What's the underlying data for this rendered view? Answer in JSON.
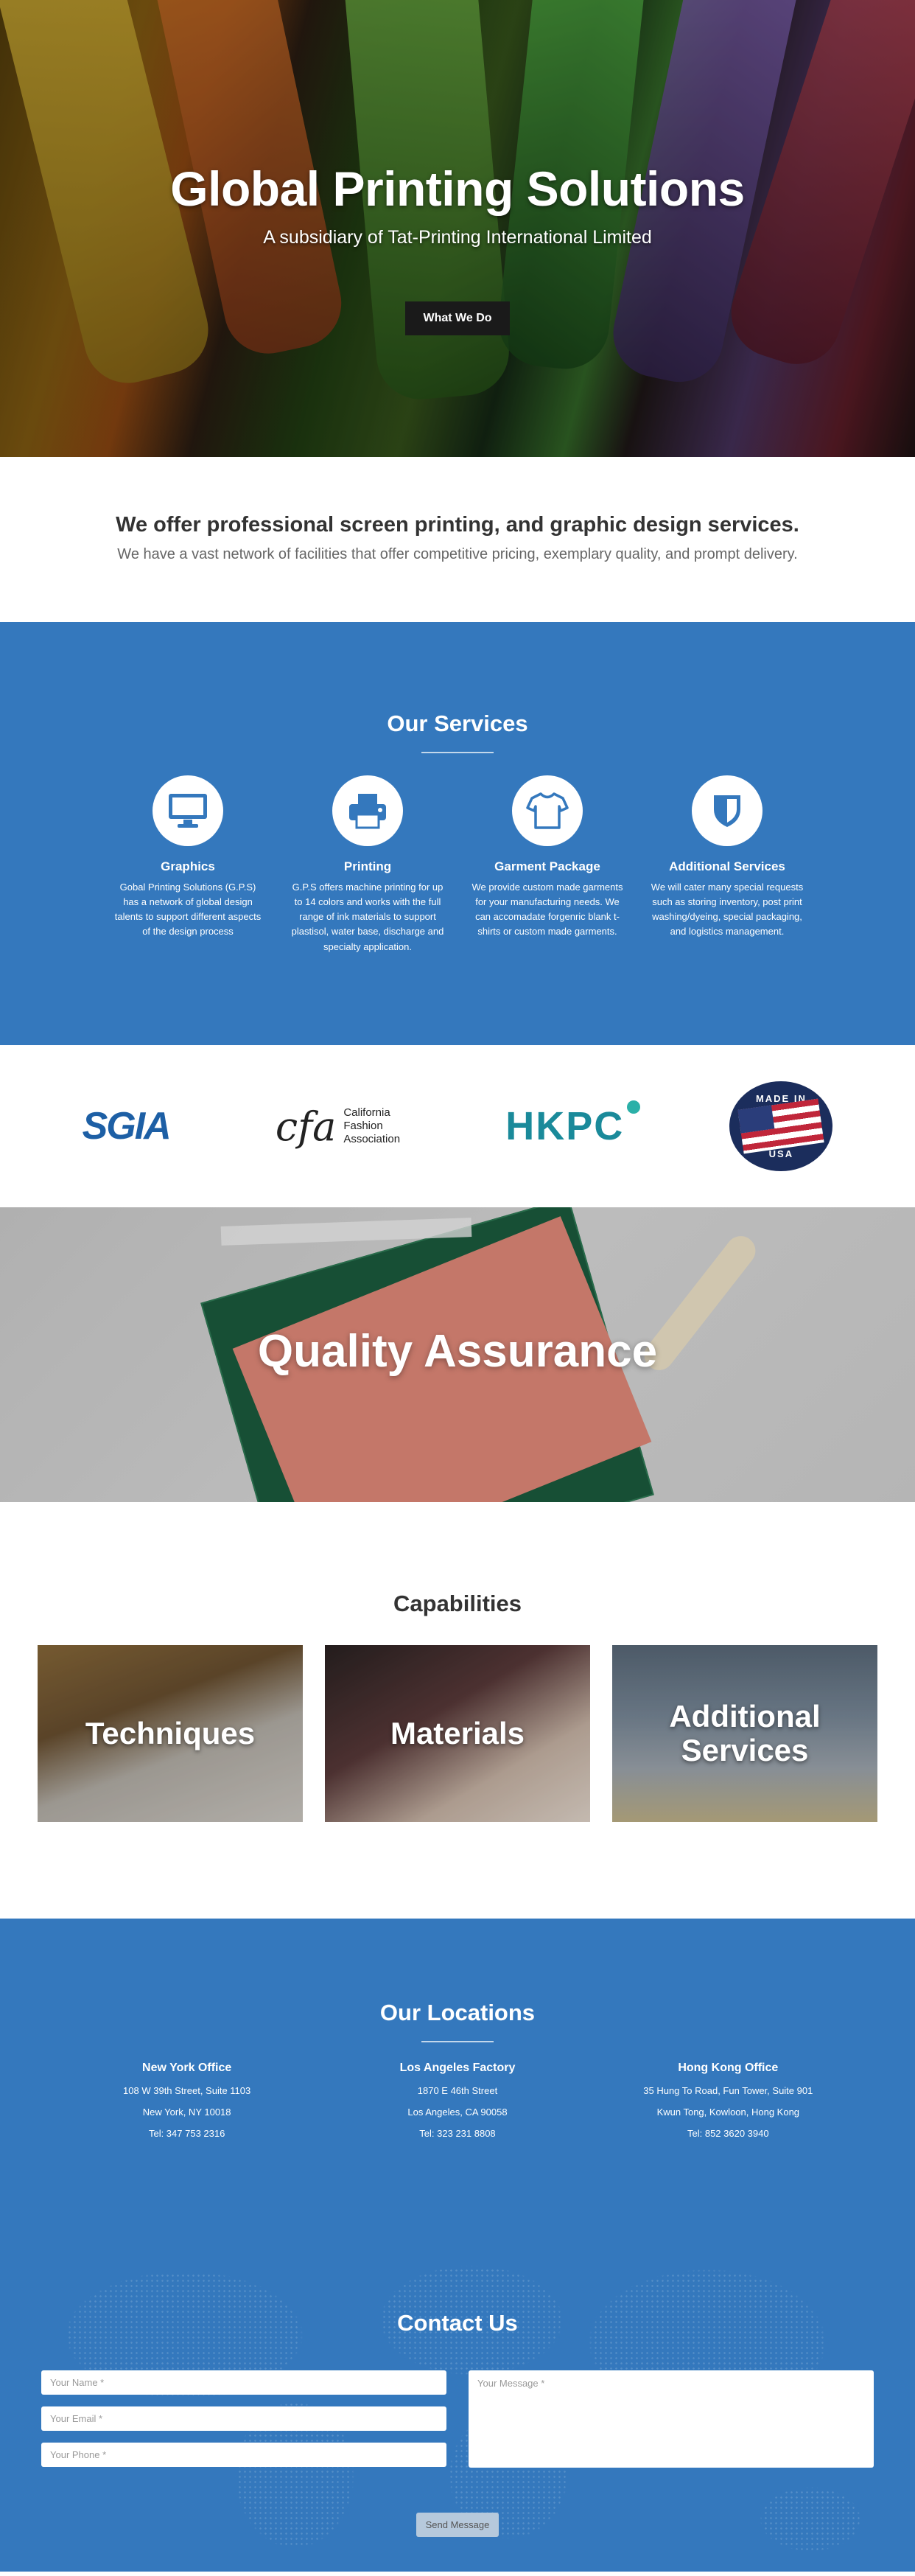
{
  "hero": {
    "title": "Global Printing Solutions",
    "subtitle": "A subsidiary of Tat-Printing International Limited",
    "button_label": "What We Do"
  },
  "intro": {
    "heading": "We offer professional screen printing, and graphic design services.",
    "subheading": "We have a vast network of facilities that offer competitive pricing, exemplary quality, and prompt delivery."
  },
  "services": {
    "title": "Our Services",
    "accent_color": "#3478bd",
    "items": [
      {
        "icon": "monitor-icon",
        "name": "Graphics",
        "description": "Gobal Printing Solutions (G.P.S) has a network of global design talents to support different aspects of the design process"
      },
      {
        "icon": "printer-icon",
        "name": "Printing",
        "description": "G.P.S offers machine printing for up to 14 colors and works with the full range of ink materials to support plastisol, water base, discharge and specialty application."
      },
      {
        "icon": "tshirt-icon",
        "name": "Garment Package",
        "description": "We provide custom made garments for your manufacturing needs. We can accomadate forgenric blank t-shirts or custom made garments."
      },
      {
        "icon": "shield-icon",
        "name": "Additional Services",
        "description": "We will cater many special requests such as storing inventory, post print washing/dyeing, special packaging, and logistics management."
      }
    ]
  },
  "partners": {
    "sgia": "SGIA",
    "cfa_mark": "cfa",
    "cfa_lines": [
      "California",
      "Fashion",
      "Association"
    ],
    "hkpc": "HKPC",
    "usa_top": "MADE IN",
    "usa_bottom": "USA"
  },
  "quality": {
    "title": "Quality Assurance"
  },
  "capabilities": {
    "title": "Capabilities",
    "cards": [
      {
        "label": "Techniques"
      },
      {
        "label": "Materials"
      },
      {
        "label": "Additional Services"
      }
    ]
  },
  "locations": {
    "title": "Our Locations",
    "offices": [
      {
        "name": "New York Office",
        "line1": "108 W 39th Street, Suite 1103",
        "line2": "New York, NY 10018",
        "phone": "Tel: 347 753 2316"
      },
      {
        "name": "Los Angeles Factory",
        "line1": "1870 E 46th Street",
        "line2": "Los Angeles, CA 90058",
        "phone": "Tel: 323 231 8808"
      },
      {
        "name": "Hong Kong Office",
        "line1": "35 Hung To Road, Fun Tower, Suite 901",
        "line2": "Kwun Tong, Kowloon, Hong Kong",
        "phone": "Tel: 852 3620 3940"
      }
    ]
  },
  "contact": {
    "title": "Contact Us",
    "name_placeholder": "Your Name *",
    "email_placeholder": "Your Email *",
    "phone_placeholder": "Your Phone *",
    "message_placeholder": "Your Message *",
    "send_label": "Send Message"
  }
}
